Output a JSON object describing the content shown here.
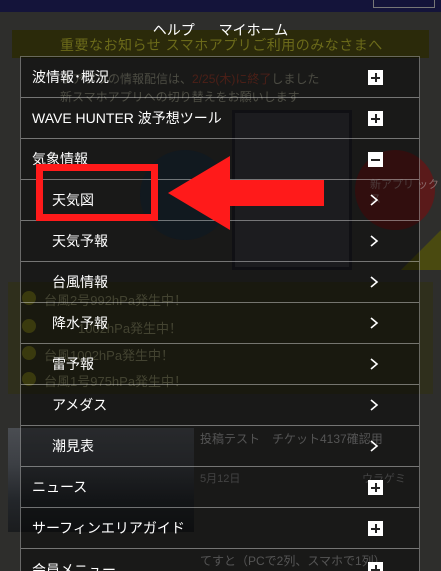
{
  "header": {
    "help_label": "ヘルプ",
    "myhome_label": "マイホーム"
  },
  "background": {
    "banner_text": "重要なお知らせ スマホアプリご利用のみなさまへ",
    "notice_line1_a": "ホアプリの情報配信は、",
    "notice_line1_date": "2/25(木)に終了",
    "notice_line1_b": "しました",
    "notice_line2": "新スマホアプリへの切り替えをお願いします",
    "circle_text": "新アプリ ックス",
    "storms": [
      "台風2号992hPa発生中！",
      "1002hPa発生中！",
      "台風1002hPa発生中！",
      "台風1号975hPa発生中！"
    ],
    "post_title": "投稿テスト　チケット4137確認用",
    "post_date": "5月12日",
    "post_tag": "ウラゲミ",
    "post2_title": "てすと（PCで2列、スマホで1列）"
  },
  "menu": {
    "items": [
      {
        "label": "波情報･概況",
        "type": "plus",
        "level": 0
      },
      {
        "label": "WAVE HUNTER 波予想ツール",
        "type": "plus",
        "level": 0
      },
      {
        "label": "気象情報",
        "type": "minus",
        "level": 0
      },
      {
        "label": "天気図",
        "type": "chevron",
        "level": 1
      },
      {
        "label": "天気予報",
        "type": "chevron",
        "level": 1
      },
      {
        "label": "台風情報",
        "type": "chevron",
        "level": 1
      },
      {
        "label": "降水予報",
        "type": "chevron",
        "level": 1
      },
      {
        "label": "雷予報",
        "type": "chevron",
        "level": 1
      },
      {
        "label": "アメダス",
        "type": "chevron",
        "level": 1
      },
      {
        "label": "潮見表",
        "type": "chevron",
        "level": 1
      },
      {
        "label": "ニュース",
        "type": "plus",
        "level": 0
      },
      {
        "label": "サーフィンエリアガイド",
        "type": "plus",
        "level": 0
      },
      {
        "label": "会員メニュー",
        "type": "plus",
        "level": 0
      }
    ]
  },
  "colors": {
    "annotation_red": "#ff1a1a",
    "menu_text": "#ffffff"
  },
  "icons": {
    "expand": "plus-icon",
    "collapse": "minus-icon",
    "navigate": "chevron-right-icon",
    "annotation": "red-arrow-left-icon"
  }
}
